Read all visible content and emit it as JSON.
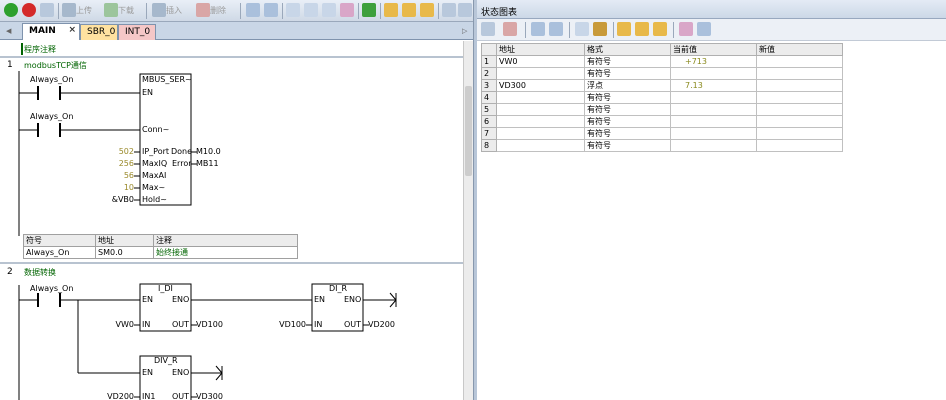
{
  "left_toolbar": {
    "upload_label": "上传",
    "download_label": "下载",
    "insert_label": "插入",
    "delete_label": "删除"
  },
  "tabs": [
    {
      "label": "MAIN",
      "close": "×"
    },
    {
      "label": "SBR_0"
    },
    {
      "label": "INT_0"
    }
  ],
  "program_comment": "程序注释",
  "network1": {
    "number": "1",
    "title": "modbusTCP通信",
    "contact1_label": "Always_On",
    "contact2_label": "Always_On",
    "box_name": "MBUS_SER~",
    "pins_left": [
      "EN",
      "Conn~",
      "IP_Port",
      "MaxIQ",
      "MaxAI",
      "Max~",
      "Hold~"
    ],
    "pin_values": [
      "502",
      "256",
      "56",
      "10",
      "&VB0"
    ],
    "pins_right": [
      "Done",
      "Error"
    ],
    "out_values": [
      "M10.0",
      "MB11"
    ],
    "symtable": {
      "headers": [
        "符号",
        "地址",
        "注释"
      ],
      "rows": [
        [
          "Always_On",
          "SM0.0",
          "始终接通"
        ]
      ]
    }
  },
  "network2": {
    "number": "2",
    "title": "数据转换",
    "contact_label": "Always_On",
    "box1": {
      "name": "I_DI",
      "en": "EN",
      "eno": "ENO",
      "in": "IN",
      "out": "OUT",
      "in_value": "VW0",
      "out_value": "VD100"
    },
    "box2": {
      "name": "DI_R",
      "en": "EN",
      "eno": "ENO",
      "in": "IN",
      "out": "OUT",
      "in_value": "VD100",
      "out_value": "VD200"
    },
    "box3": {
      "name": "DIV_R",
      "en": "EN",
      "eno": "ENO",
      "in": "IN1",
      "out": "OUT",
      "in_value": "VD200",
      "out_value": "VD300"
    }
  },
  "status_chart": {
    "title": "状态图表",
    "headers": [
      "地址",
      "格式",
      "当前值",
      "新值"
    ],
    "rows": [
      {
        "n": "1",
        "addr": "VW0",
        "fmt": "有符号",
        "cur": "+713",
        "new": ""
      },
      {
        "n": "2",
        "addr": "",
        "fmt": "有符号",
        "cur": "",
        "new": ""
      },
      {
        "n": "3",
        "addr": "VD300",
        "fmt": "浮点",
        "cur": "7.13",
        "new": ""
      },
      {
        "n": "4",
        "addr": "",
        "fmt": "有符号",
        "cur": "",
        "new": ""
      },
      {
        "n": "5",
        "addr": "",
        "fmt": "有符号",
        "cur": "",
        "new": ""
      },
      {
        "n": "6",
        "addr": "",
        "fmt": "有符号",
        "cur": "",
        "new": ""
      },
      {
        "n": "7",
        "addr": "",
        "fmt": "有符号",
        "cur": "",
        "new": ""
      },
      {
        "n": "8",
        "addr": "",
        "fmt": "有符号",
        "cur": "",
        "new": ""
      }
    ]
  },
  "colors": {
    "comment_green": "#006400",
    "value_olive": "#8a8a1e",
    "tab_sbr": "#ffe2a0",
    "tab_int": "#f5c7c7"
  }
}
